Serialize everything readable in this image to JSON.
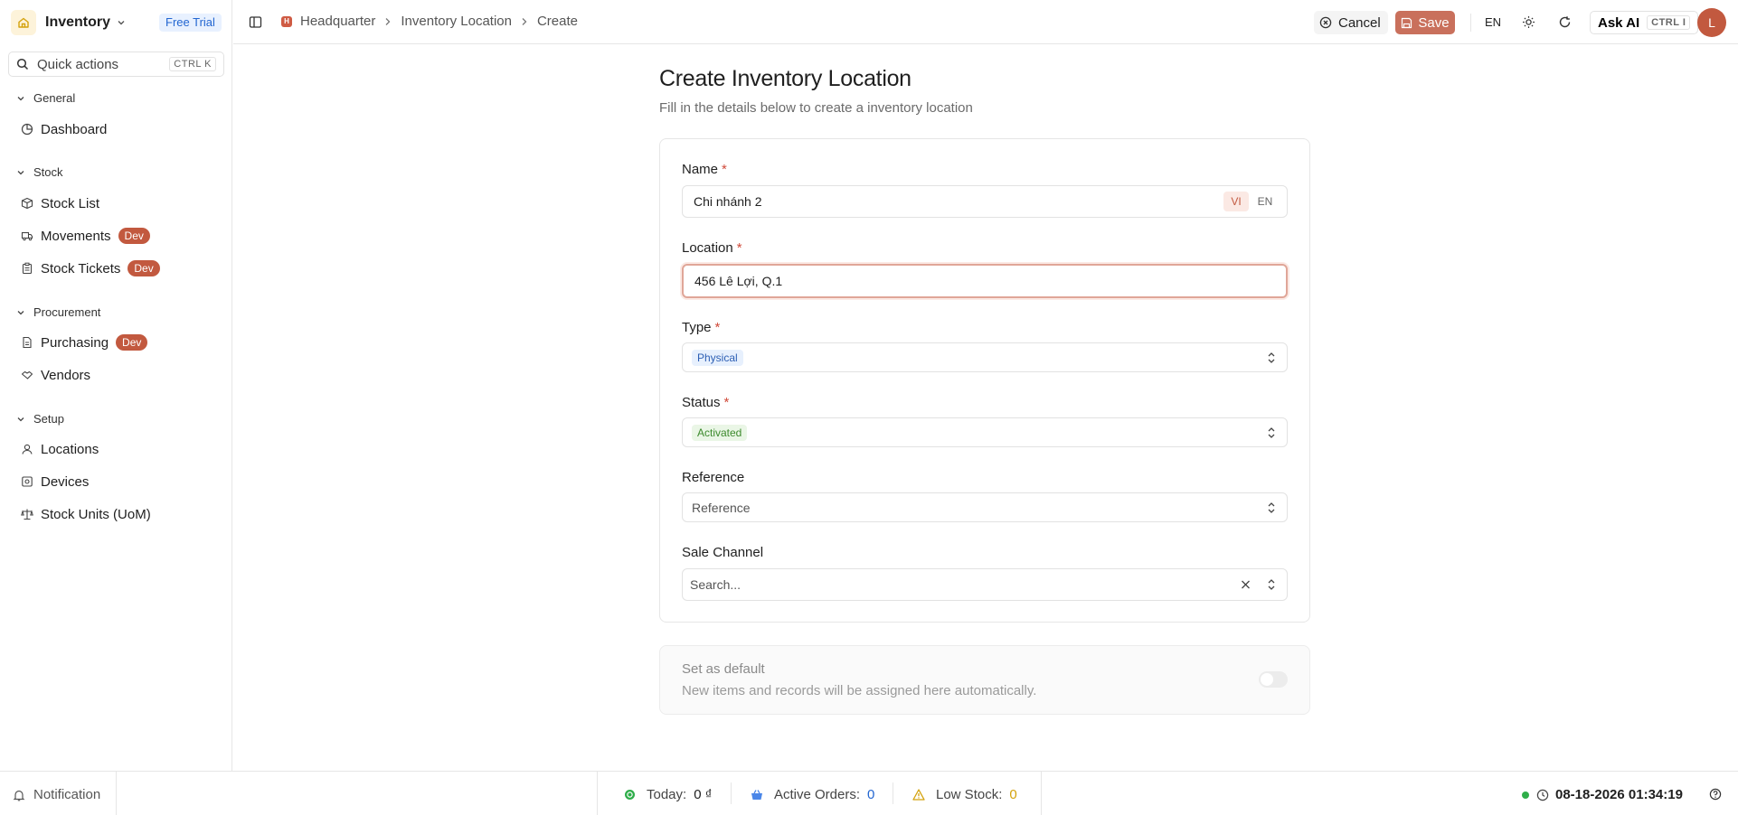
{
  "app": {
    "name": "Inventory",
    "trial_badge": "Free Trial"
  },
  "quick_actions": {
    "placeholder": "Quick actions",
    "shortcut": "CTRL K"
  },
  "sidebar": {
    "sections": [
      {
        "title": "General",
        "items": [
          {
            "label": "Dashboard",
            "icon": "pie-chart-icon"
          }
        ]
      },
      {
        "title": "Stock",
        "items": [
          {
            "label": "Stock List",
            "icon": "boxes-icon"
          },
          {
            "label": "Movements",
            "icon": "truck-icon",
            "badge": "Dev"
          },
          {
            "label": "Stock Tickets",
            "icon": "clipboard-icon",
            "badge": "Dev"
          }
        ]
      },
      {
        "title": "Procurement",
        "items": [
          {
            "label": "Purchasing",
            "icon": "document-icon",
            "badge": "Dev"
          },
          {
            "label": "Vendors",
            "icon": "handshake-icon"
          }
        ]
      },
      {
        "title": "Setup",
        "items": [
          {
            "label": "Locations",
            "icon": "user-pin-icon"
          },
          {
            "label": "Devices",
            "icon": "device-icon"
          },
          {
            "label": "Stock Units (UoM)",
            "icon": "scale-icon"
          }
        ]
      }
    ]
  },
  "breadcrumb": {
    "root": "Headquarter",
    "root_initial": "H",
    "middle": "Inventory Location",
    "current": "Create"
  },
  "toolbar": {
    "cancel": "Cancel",
    "save": "Save",
    "language": "EN",
    "ask_ai": "Ask AI",
    "ask_ai_shortcut": "CTRL I",
    "avatar_initial": "L"
  },
  "form": {
    "title": "Create Inventory Location",
    "subtitle": "Fill in the details below to create a inventory location",
    "name": {
      "label": "Name",
      "value": "Chi nhánh 2",
      "lang_options": [
        "VI",
        "EN"
      ],
      "active_lang": "VI"
    },
    "location": {
      "label": "Location",
      "value": "456 Lê Lợi, Q.1"
    },
    "type": {
      "label": "Type",
      "value": "Physical"
    },
    "status": {
      "label": "Status",
      "value": "Activated"
    },
    "reference": {
      "label": "Reference",
      "placeholder": "Reference"
    },
    "sale_channel": {
      "label": "Sale Channel",
      "placeholder": "Search..."
    },
    "required_mark": "*",
    "set_default": {
      "title": "Set as default",
      "description": "New items and records will be assigned here automatically.",
      "enabled": false
    }
  },
  "statusbar": {
    "notification": "Notification",
    "today": {
      "label": "Today:",
      "value": "0 ₫"
    },
    "active_orders": {
      "label": "Active Orders:",
      "value": "0"
    },
    "low_stock": {
      "label": "Low Stock:",
      "value": "0"
    },
    "datetime": "08-18-2026 01:34:19"
  },
  "colors": {
    "accent": "#c2593f",
    "save_button": "#c9705c",
    "online": "#2fae4a",
    "low_stock_value": "#d4a20c",
    "orders_value": "#2366d1"
  }
}
